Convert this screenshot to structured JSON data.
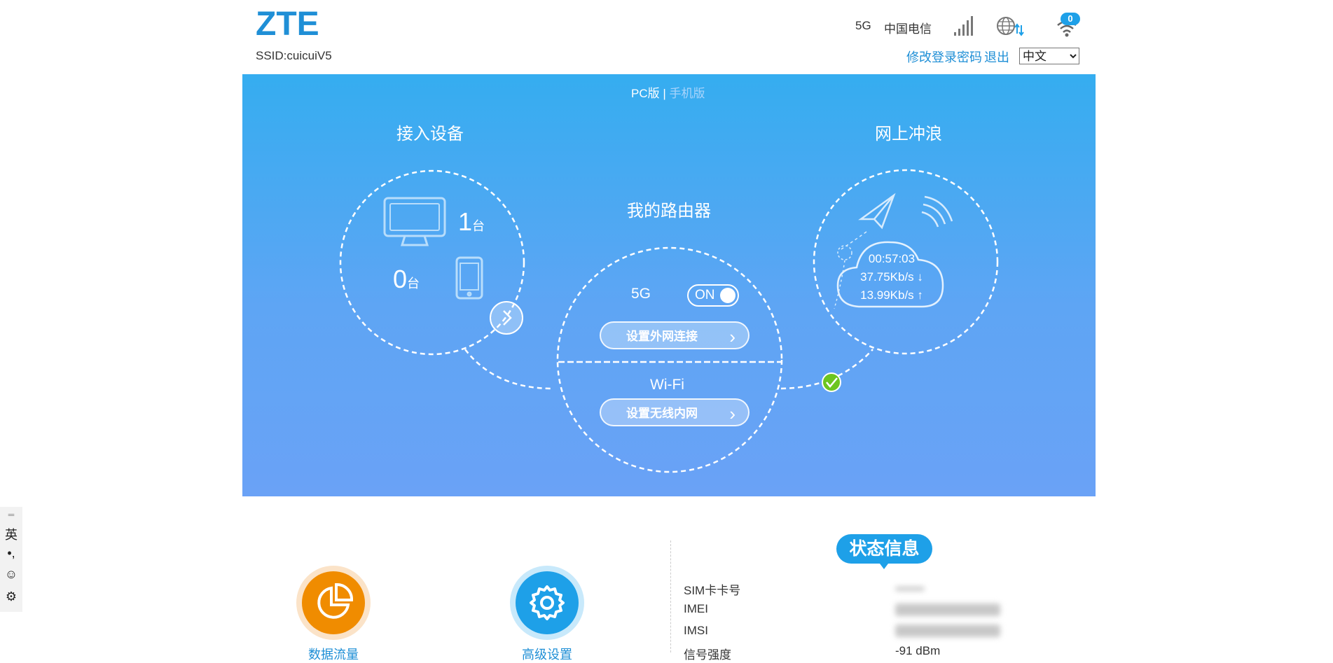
{
  "header": {
    "logo_text": "ZTE",
    "ssid": "SSID:cuicuiV5",
    "network_type": "5G",
    "carrier": "中国电信",
    "wifi_clients_badge": "0",
    "change_password": "修改登录密码",
    "logout": "退出",
    "language_selected": "中文",
    "icons": [
      "signal-strength-icon",
      "globe-transfer-icon",
      "wifi-icon"
    ]
  },
  "hero": {
    "mode_pc": "PC版",
    "mode_separator": "|",
    "mode_mobile": "手机版",
    "devices": {
      "title": "接入设备",
      "pc_count": "1",
      "pc_unit": "台",
      "mobile_count": "0",
      "mobile_unit": "台"
    },
    "router": {
      "title": "我的路由器",
      "label_5g": "5G",
      "toggle_state": "ON",
      "wan_button": "设置外网连接",
      "wifi_label": "Wi-Fi",
      "lan_button": "设置无线内网"
    },
    "surf": {
      "title": "网上冲浪",
      "duration": "00:57:03",
      "download": "37.75Kb/s ↓",
      "upload": "13.99Kb/s ↑"
    },
    "connected": true
  },
  "tiles": [
    {
      "label": "数据流量",
      "icon": "pie-chart-icon",
      "color": "#f08c00"
    },
    {
      "label": "高级设置",
      "icon": "gear-icon",
      "color": "#1ea0e8"
    }
  ],
  "status": {
    "title": "状态信息",
    "rows": [
      {
        "label": "SIM卡卡号"
      },
      {
        "label": "IMEI"
      },
      {
        "label": "IMSI"
      },
      {
        "label": "信号强度",
        "value": "-91 dBm"
      }
    ]
  },
  "ime_toolbar": {
    "items": [
      "英",
      "•,",
      "☺",
      "⚙"
    ]
  },
  "colors": {
    "brand_blue": "#1f8fd6",
    "hero_top": "#35adf0",
    "hero_bottom": "#6aa2f6",
    "ok_green": "#6cc51f"
  }
}
